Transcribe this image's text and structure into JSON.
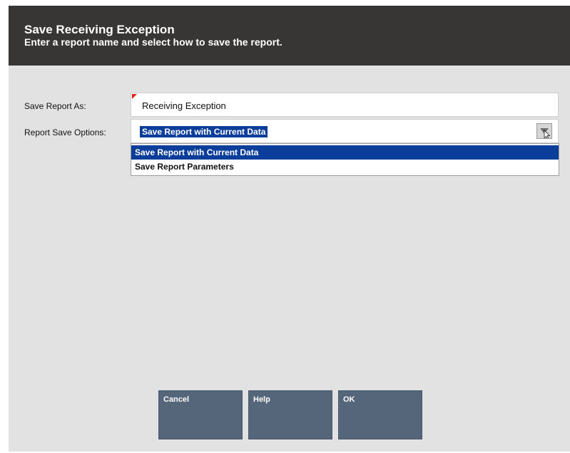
{
  "dialog": {
    "title": "Save Receiving Exception",
    "subtitle": "Enter a report name and select how to save the report."
  },
  "form": {
    "save_as_label": "Save Report As:",
    "save_as_value": "Receiving Exception",
    "options_label": "Report Save Options:",
    "selected_option": "Save Report with Current Data",
    "options": [
      "Save Report with Current Data",
      "Save Report Parameters"
    ]
  },
  "buttons": {
    "cancel": "Cancel",
    "help": "Help",
    "ok": "OK"
  },
  "colors": {
    "header_bg": "#383634",
    "body_bg": "#e2e2e2",
    "selection": "#0a3e9a",
    "button_bg": "#56667a",
    "required_marker": "#e21f1f"
  }
}
